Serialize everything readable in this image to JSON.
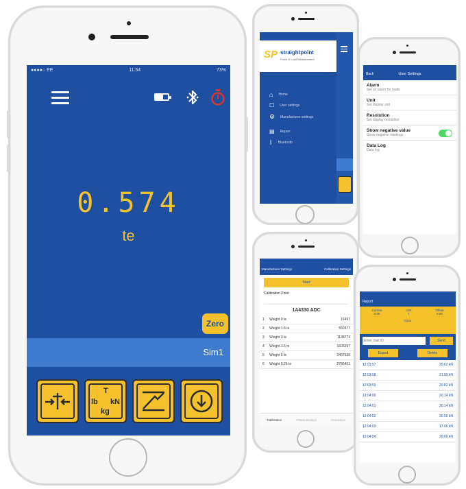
{
  "colors": {
    "primary_blue": "#1e4fa0",
    "accent_yellow": "#f4c22a",
    "stopwatch_red": "#e0352b",
    "toggle_green": "#4cd964"
  },
  "main_phone": {
    "status": {
      "carrier": "●●●●○ EE",
      "time": "11:54",
      "battery": "73%"
    },
    "toolbar_icons": [
      "menu-icon",
      "battery-icon",
      "bluetooth-icon",
      "stopwatch-icon"
    ],
    "reading": {
      "value": "0.574",
      "unit": "te"
    },
    "zero_button": "Zero",
    "device_name": "Sim1",
    "bottom_buttons": [
      "zero-function-icon",
      "units-icon",
      "peak-icon",
      "save-icon"
    ],
    "units_labels": {
      "t": "T",
      "lb": "lb",
      "kn": "kN",
      "kg": "kg"
    }
  },
  "menu_phone": {
    "brand": {
      "logo": "SP",
      "name": "straightpoint",
      "tagline": "Force & Load Measurement"
    },
    "menu_items": [
      "Home",
      "User settings",
      "Manufacturer settings",
      "Report",
      "Bluetooth"
    ]
  },
  "settings_phone": {
    "back_label": "Back",
    "title": "User Settings",
    "items": [
      {
        "title": "Alarm",
        "sub": "Set an alarm for loads"
      },
      {
        "title": "Unit",
        "sub": "Set display unit"
      },
      {
        "title": "Resolution",
        "sub": "Set display resolution"
      },
      {
        "title": "Show negative value",
        "sub": "Show negative readings"
      },
      {
        "title": "Data Log",
        "sub": "Data log"
      }
    ],
    "negative_toggle_on": true
  },
  "calibration_phone": {
    "back_label": "Manufacturer Settings",
    "title": "Calibration Settings",
    "start_button": "Start",
    "section_title": "Calibration Point",
    "adc_label": "1A4330 ADC",
    "rows": [
      {
        "n": "1",
        "label": "Weight 0 te",
        "value": "16497"
      },
      {
        "n": "2",
        "label": "Weight 1.6 te",
        "value": "550377"
      },
      {
        "n": "3",
        "label": "Weight 3 te",
        "value": "1138774"
      },
      {
        "n": "4",
        "label": "Weight 3.5 te",
        "value": "1603297"
      },
      {
        "n": "5",
        "label": "Weight 5 te",
        "value": "2457638"
      },
      {
        "n": "6",
        "label": "Weight 5.26 te",
        "value": "2786451"
      }
    ],
    "tabs": [
      "Calibration",
      "Characteristics",
      "Resolution"
    ]
  },
  "report_phone": {
    "back_label": "Report",
    "summary": {
      "labels": [
        "Current",
        "Unit",
        "Offset"
      ],
      "values": [
        "0.00",
        "t",
        "0.00"
      ]
    },
    "clear_label": "Clear",
    "email_placeholder": "Enter mail ID",
    "send_button": "Send",
    "export_button": "Export",
    "delete_button": "Delete",
    "rows": [
      {
        "time": "12:03:57",
        "value": "20.62 kN"
      },
      {
        "time": "12:03:58",
        "value": "21.00 kN"
      },
      {
        "time": "12:03:59",
        "value": "20.82 kN"
      },
      {
        "time": "12:04:00",
        "value": "20.14 kN"
      },
      {
        "time": "12:04:01",
        "value": "20.14 kN"
      },
      {
        "time": "12:04:02",
        "value": "20.50 kN"
      },
      {
        "time": "12:04:03",
        "value": "17.06 kN"
      },
      {
        "time": "12:04:04",
        "value": "20.06 kN"
      }
    ]
  }
}
